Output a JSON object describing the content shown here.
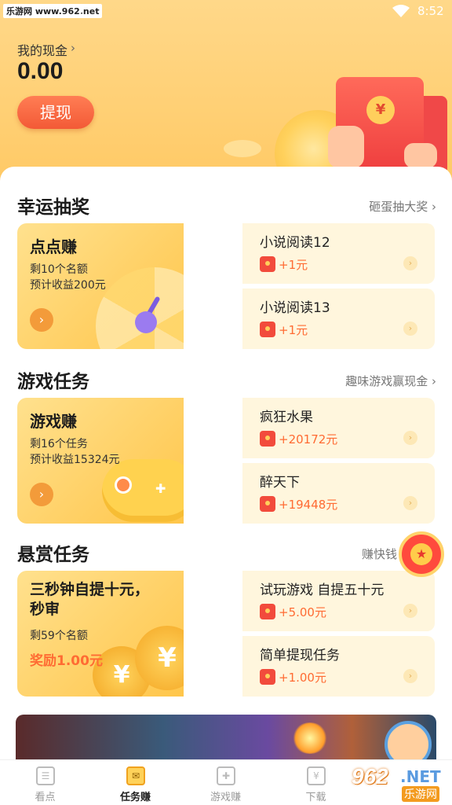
{
  "status_bar": {
    "brand": "乐游网 www.962.net",
    "time": "8:52"
  },
  "wallet": {
    "label": "我的现金",
    "amount": "0.00",
    "withdraw_label": "提现"
  },
  "sections": [
    {
      "title": "幸运抽奖",
      "link": "砸蛋抽大奖",
      "feature": {
        "title": "点点赚",
        "line1": "剩10个名额",
        "line2": "预计收益200元"
      },
      "tasks": [
        {
          "title": "小说阅读12",
          "reward": "+1元"
        },
        {
          "title": "小说阅读13",
          "reward": "+1元"
        }
      ]
    },
    {
      "title": "游戏任务",
      "link": "趣味游戏赢现金",
      "feature": {
        "title": "游戏赚",
        "line1": "剩16个任务",
        "line2": "预计收益15324元"
      },
      "tasks": [
        {
          "title": "疯狂水果",
          "reward": "+20172元"
        },
        {
          "title": "醉天下",
          "reward": "+19448元"
        }
      ]
    },
    {
      "title": "悬赏任务",
      "link": "赚快钱",
      "feature": {
        "title_line1": "三秒钟自提十元，",
        "title_line2": "秒审",
        "line1": "剩59个名额",
        "reward": "奖励1.00元"
      },
      "tasks": [
        {
          "title": "试玩游戏 自提五十元",
          "reward": "+5.00元"
        },
        {
          "title": "简单提现任务",
          "reward": "+1.00元"
        }
      ]
    }
  ],
  "bottom_nav": [
    {
      "label": "看点",
      "active": false
    },
    {
      "label": "任务赚",
      "active": true
    },
    {
      "label": "游戏赚",
      "active": false
    },
    {
      "label": "下载",
      "active": false
    }
  ],
  "watermark": {
    "num": "962",
    "net": ".NET",
    "sub": "乐游网"
  },
  "icons": {
    "red_envelope": "red-envelope-icon",
    "chevron": "chevron-right-icon",
    "yuan": "yuan-coin-icon"
  },
  "colors": {
    "header_bg": "#ffd27a",
    "accent_orange": "#ff6b33",
    "button_red": "#f35a36",
    "task_card_bg": "#fff6dd"
  }
}
